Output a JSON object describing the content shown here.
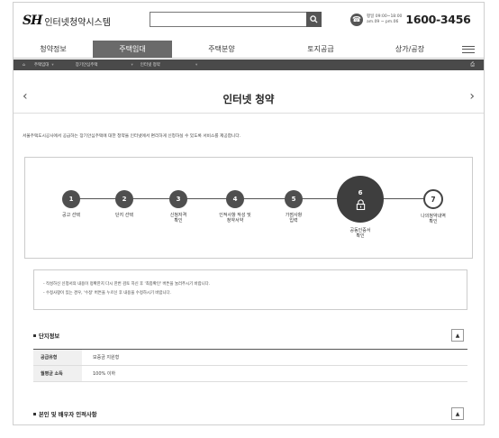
{
  "header": {
    "logo_mark": "SH",
    "logo_name": "인터넷청약시스템",
    "call_info_line1": "평일 09:00~18:00",
    "call_info_line2": "am.09 ~ pm.06",
    "phone_number": "1600-3456"
  },
  "nav": {
    "items": [
      {
        "label": "청약정보"
      },
      {
        "label": "주택임대"
      },
      {
        "label": "주택분양"
      },
      {
        "label": "토지공급"
      },
      {
        "label": "상가/공장"
      }
    ],
    "active_index": 1
  },
  "breadcrumb": {
    "home": "⌂",
    "items": [
      "주택임대",
      "장기안심주택",
      "인터넷 청약"
    ]
  },
  "page": {
    "title": "인터넷 청약",
    "intro": "서울주택도시공사에서 공급하는 장기안심주택에 대한 청약을 인터넷에서 편리하게 신청하실 수 있도록 서비스를 제공합니다."
  },
  "steps": [
    {
      "num": "1",
      "label": "공고 선택"
    },
    {
      "num": "2",
      "label": "단지 선택"
    },
    {
      "num": "3",
      "label": "신청자격\n확인"
    },
    {
      "num": "4",
      "label": "인적사항 작성 및\n청약서약"
    },
    {
      "num": "5",
      "label": "가점사항\n입력"
    },
    {
      "num": "6",
      "label": "공동인증서\n확인"
    },
    {
      "num": "7",
      "label": "나의청약내역\n확인"
    }
  ],
  "notice": [
    "- 작성하신 신청서의 내용이 정확한지 다시 한번 검토 하신 후 '최종확인' 버튼을 눌러주시기 바랍니다.",
    "- 수정사항이 있는 경우, '수정' 버튼을 누르신 후 내용을 수정하시기 바랍니다."
  ],
  "complex_info": {
    "heading": "단지정보",
    "rows": [
      {
        "label": "공급유형",
        "value": "보증금 지원형"
      },
      {
        "label": "월평균 소득",
        "value": "100% 이하"
      }
    ]
  },
  "personal_section": {
    "heading": "본인 및 배우자 인적사항"
  }
}
